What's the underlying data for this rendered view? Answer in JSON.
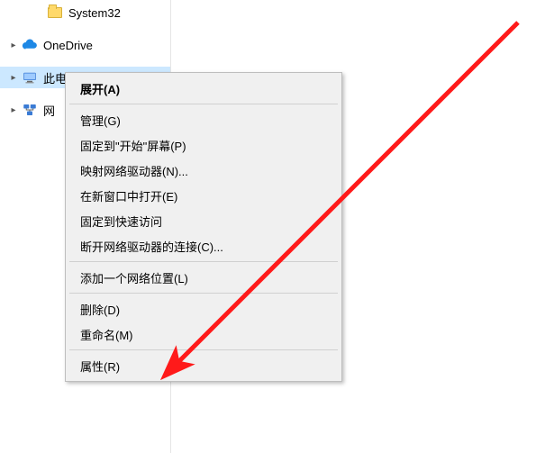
{
  "tree": {
    "items": [
      {
        "label": "System32",
        "indent": 36,
        "expander": "",
        "icon": "folder"
      },
      {
        "label": "OneDrive",
        "indent": 8,
        "expander": "▸",
        "icon": "cloud"
      },
      {
        "label": "此电脑",
        "indent": 8,
        "expander": "▸",
        "icon": "pc",
        "selected": true
      },
      {
        "label": "网",
        "indent": 8,
        "expander": "▸",
        "icon": "network"
      }
    ]
  },
  "contextMenu": {
    "items": [
      {
        "label": "展开(A)",
        "bold": true
      },
      {
        "sep": true
      },
      {
        "label": "管理(G)"
      },
      {
        "label": "固定到\"开始\"屏幕(P)"
      },
      {
        "label": "映射网络驱动器(N)..."
      },
      {
        "label": "在新窗口中打开(E)"
      },
      {
        "label": "固定到快速访问"
      },
      {
        "label": "断开网络驱动器的连接(C)..."
      },
      {
        "sep": true
      },
      {
        "label": "添加一个网络位置(L)"
      },
      {
        "sep": true
      },
      {
        "label": "删除(D)"
      },
      {
        "label": "重命名(M)"
      },
      {
        "sep": true
      },
      {
        "label": "属性(R)"
      }
    ]
  },
  "annotation": {
    "type": "arrow",
    "color": "#ff1a1a"
  }
}
